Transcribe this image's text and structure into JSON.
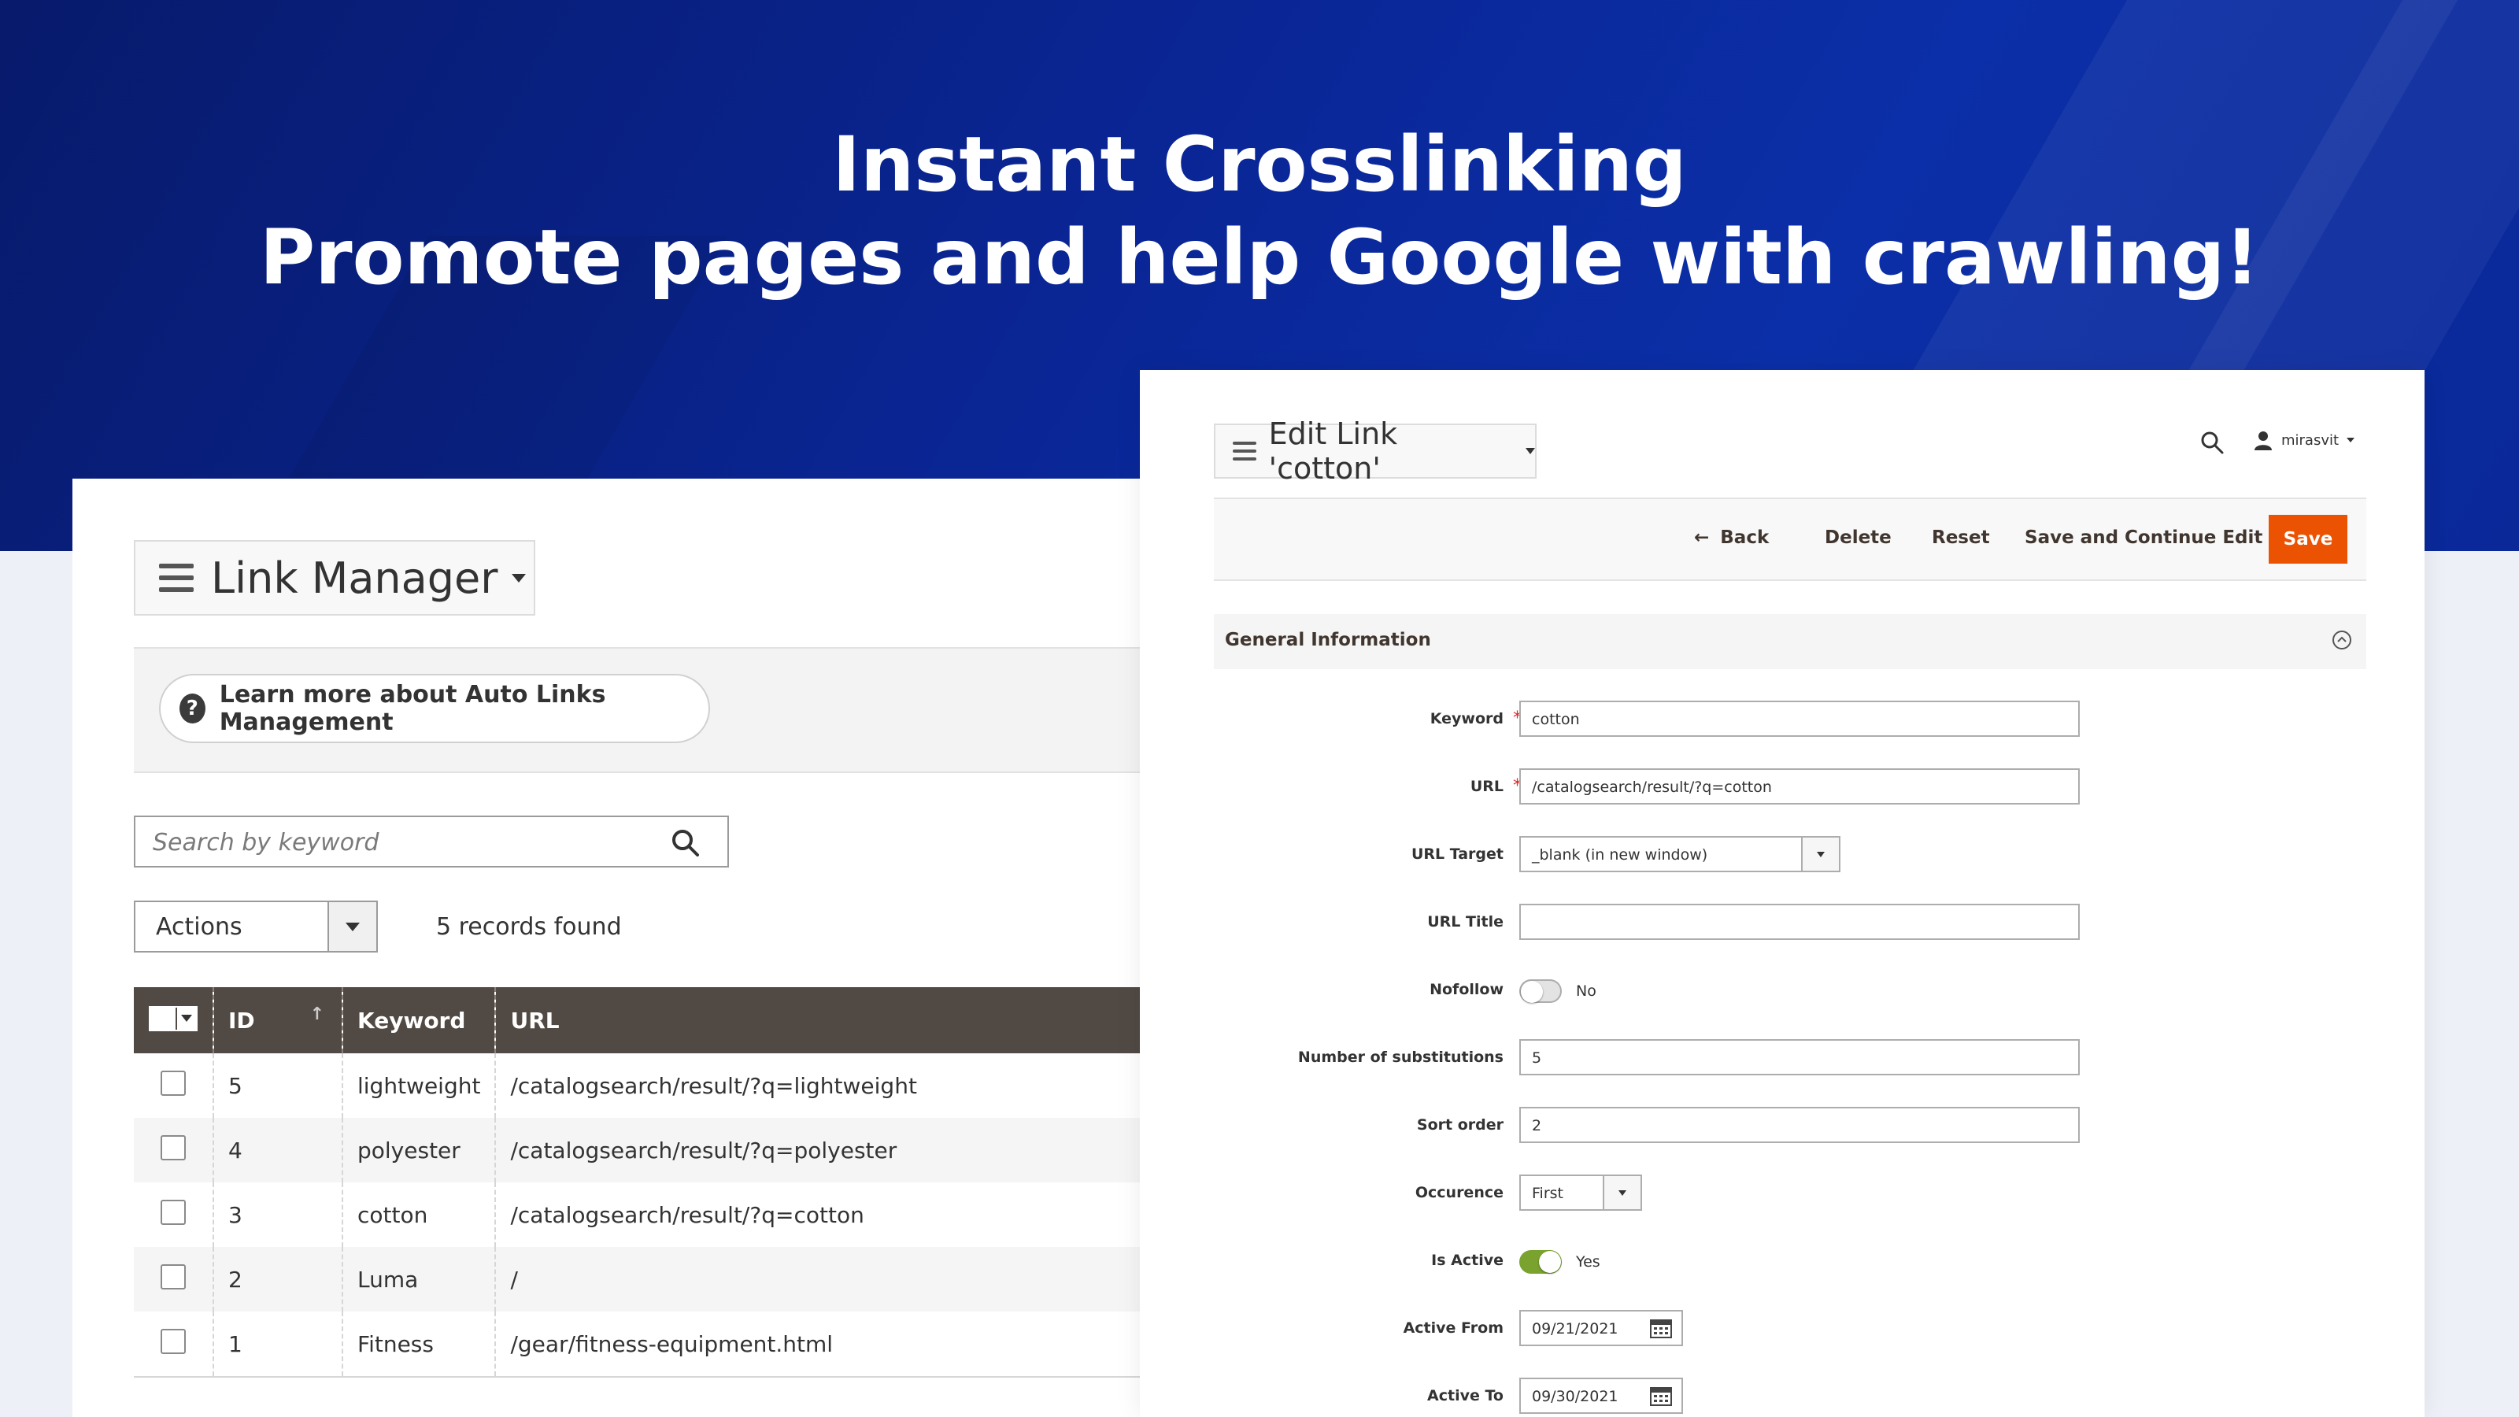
{
  "headline": {
    "line1": "Instant Crosslinking",
    "line2": "Promote pages and help Google with crawling!"
  },
  "colors": {
    "hero_bg": "#0a2696",
    "grid_header": "#514943",
    "save_button": "#eb5202",
    "toggle_on": "#79a22e"
  },
  "link_manager": {
    "title": "Link Manager",
    "learn_more": "Learn more about Auto Links Management",
    "search_placeholder": "Search by keyword",
    "actions_label": "Actions",
    "records_found": "5 records found",
    "columns": [
      "ID",
      "Keyword",
      "URL"
    ],
    "rows": [
      {
        "id": "5",
        "keyword": "lightweight",
        "url": "/catalogsearch/result/?q=lightweight"
      },
      {
        "id": "4",
        "keyword": "polyester",
        "url": "/catalogsearch/result/?q=polyester"
      },
      {
        "id": "3",
        "keyword": "cotton",
        "url": "/catalogsearch/result/?q=cotton"
      },
      {
        "id": "2",
        "keyword": "Luma",
        "url": "/"
      },
      {
        "id": "1",
        "keyword": "Fitness",
        "url": "/gear/fitness-equipment.html"
      }
    ]
  },
  "edit_link": {
    "title": "Edit Link 'cotton'",
    "user": "mirasvit",
    "buttons": {
      "back": "Back",
      "delete": "Delete",
      "reset": "Reset",
      "save_continue": "Save and Continue Edit",
      "save": "Save"
    },
    "section_title": "General Information",
    "fields": {
      "keyword": {
        "label": "Keyword",
        "value": "cotton"
      },
      "url": {
        "label": "URL",
        "value": "/catalogsearch/result/?q=cotton"
      },
      "url_target": {
        "label": "URL Target",
        "value": "_blank (in new window)"
      },
      "url_title": {
        "label": "URL Title",
        "value": ""
      },
      "nofollow": {
        "label": "Nofollow",
        "value": "No"
      },
      "substitutions": {
        "label": "Number of substitutions",
        "value": "5"
      },
      "sort_order": {
        "label": "Sort order",
        "value": "2"
      },
      "occurence": {
        "label": "Occurence",
        "value": "First"
      },
      "is_active": {
        "label": "Is Active",
        "value": "Yes"
      },
      "active_from": {
        "label": "Active From",
        "value": "09/21/2021"
      },
      "active_to": {
        "label": "Active To",
        "value": "09/30/2021"
      }
    }
  }
}
